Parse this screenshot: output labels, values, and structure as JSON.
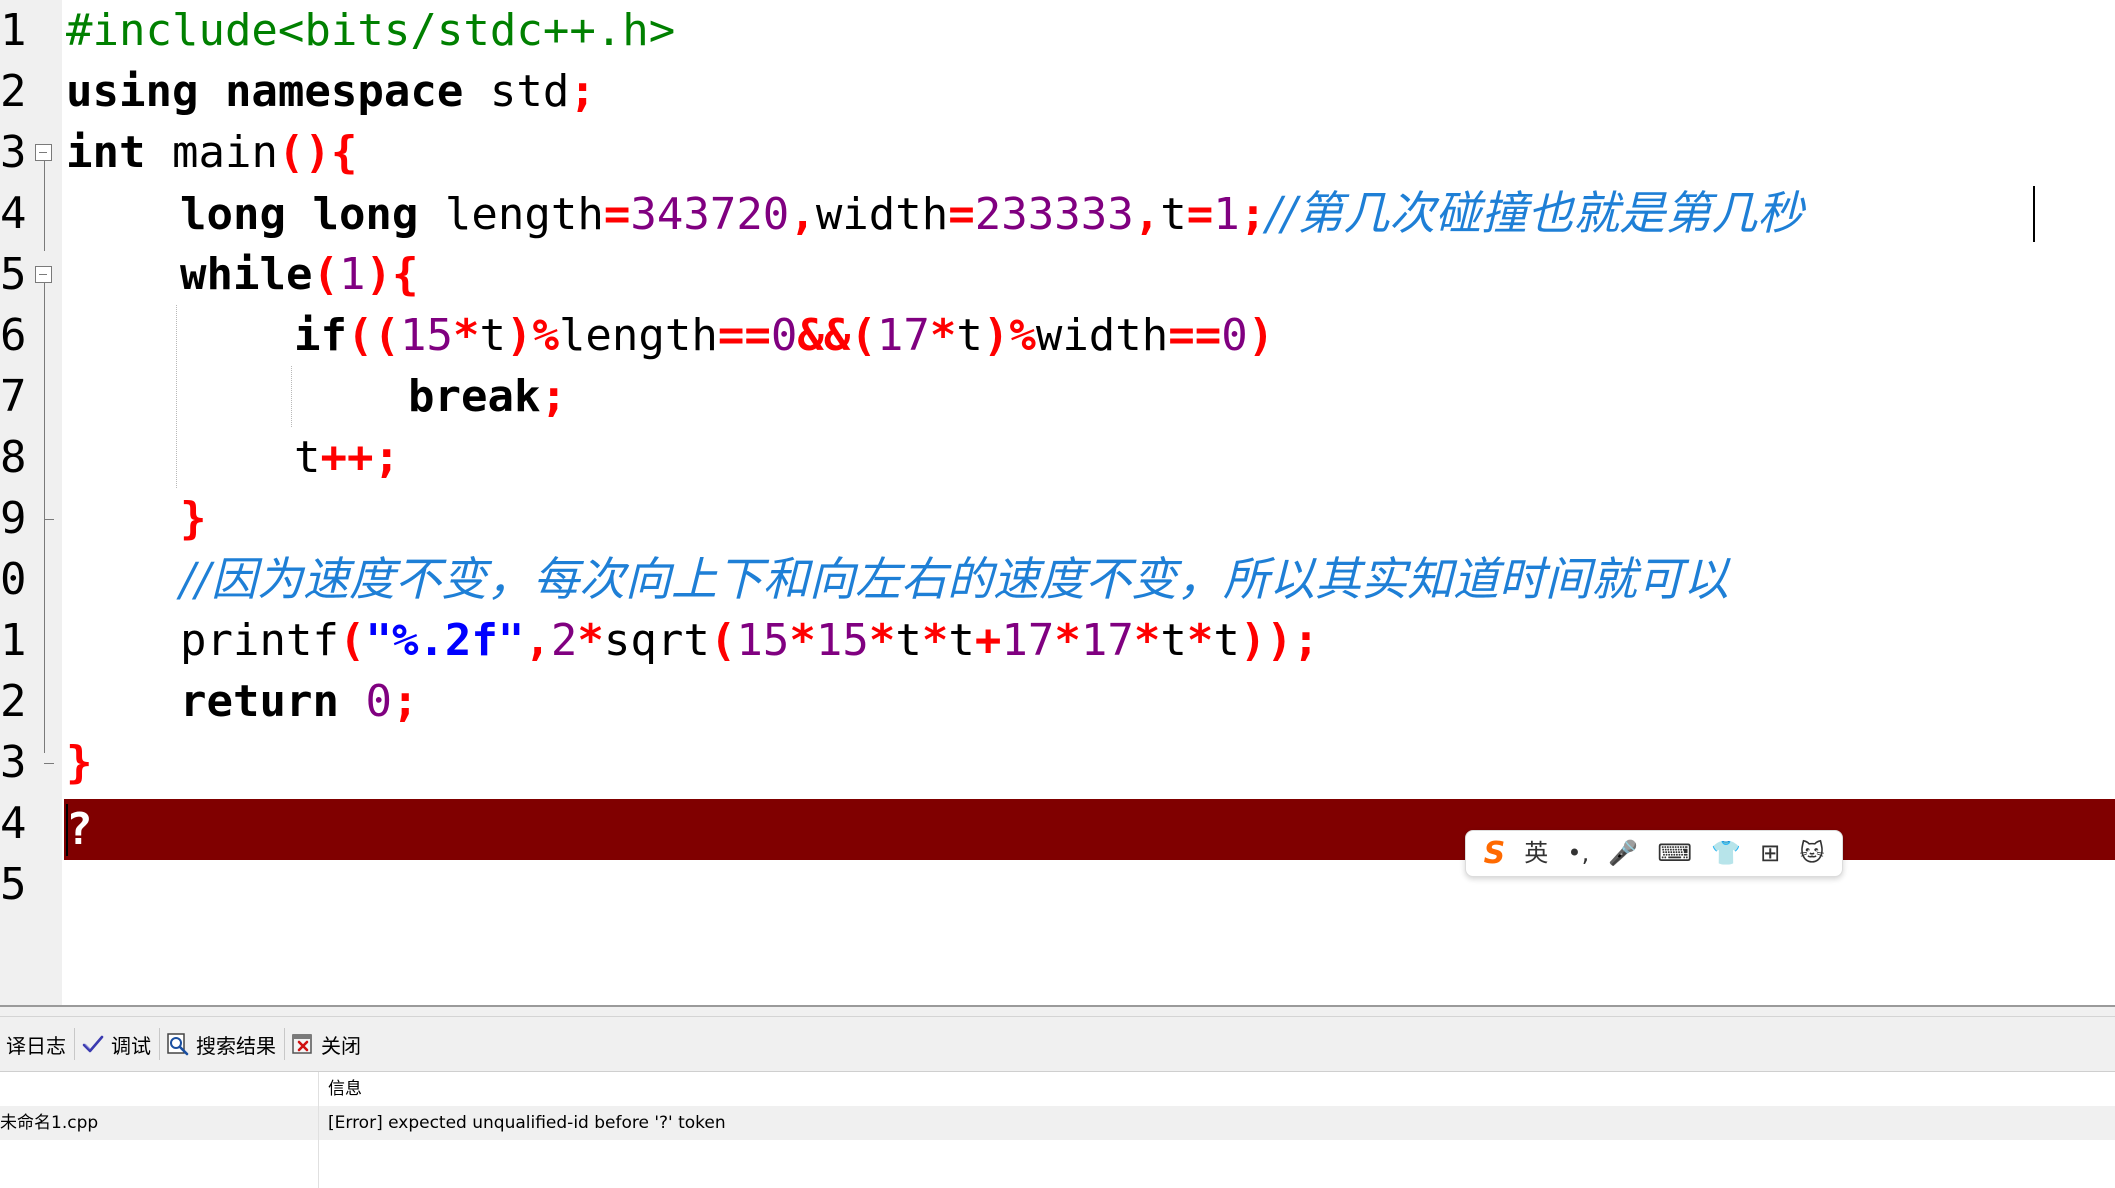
{
  "editor": {
    "line_numbers": [
      "1",
      "2",
      "3",
      "4",
      "5",
      "6",
      "7",
      "8",
      "9",
      "0",
      "1",
      "2",
      "3",
      "4",
      "5"
    ],
    "code": {
      "l1_include": "#include<bits/stdc++.h>",
      "l2_using": "using namespace",
      "l2_std": " std",
      "l2_semi": ";",
      "l3_int": "int",
      "l3_main": " main",
      "l3_paren": "(){",
      "l4_long": "long long",
      "l4_length": " length",
      "l4_eq1": "=",
      "l4_v1": "343720",
      "l4_c1": ",",
      "l4_width": "width",
      "l4_eq2": "=",
      "l4_v2": "233333",
      "l4_c2": ",",
      "l4_t": "t",
      "l4_eq3": "=",
      "l4_v3": "1",
      "l4_semi": ";",
      "l4_comment": "//第几次碰撞也就是第几秒",
      "l5_while": "while",
      "l5_open": "(",
      "l5_one": "1",
      "l5_close": "){",
      "l6_if": "if",
      "l6_a": "((",
      "l6_15": "15",
      "l6_b": "*",
      "l6_t1": "t",
      "l6_c": ")%",
      "l6_length": "length",
      "l6_d": "==",
      "l6_0a": "0",
      "l6_e": "&&(",
      "l6_17": "17",
      "l6_f": "*",
      "l6_t2": "t",
      "l6_g": ")%",
      "l6_width": "width",
      "l6_h": "==",
      "l6_0b": "0",
      "l6_i": ")",
      "l7_break": "break",
      "l7_semi": ";",
      "l8_t": "t",
      "l8_ops": "++;",
      "l9_brace": "}",
      "l10_comment": "//因为速度不变，每次向上下和向左右的速度不变，所以其实知道时间就可以",
      "l11_printf": "printf",
      "l11_open": "(",
      "l11_str": "\"%.2f\"",
      "l11_comma": ",",
      "l11_2": "2",
      "l11_m1": "*",
      "l11_sqrt": "sqrt",
      "l11_o2": "(",
      "l11_a": "15",
      "l11_m2": "*",
      "l11_b": "15",
      "l11_m3": "*",
      "l11_t1": "t",
      "l11_m4": "*",
      "l11_t2": "t",
      "l11_plus": "+",
      "l11_c": "17",
      "l11_m5": "*",
      "l11_d": "17",
      "l11_m6": "*",
      "l11_t3": "t",
      "l11_m7": "*",
      "l11_t4": "t",
      "l11_end": "));",
      "l12_return": "return",
      "l12_zero": " 0",
      "l12_semi": ";",
      "l13_brace": "}",
      "l14_error_char": "?"
    }
  },
  "ime_toolbar": {
    "logo": "S",
    "lang": "英",
    "items": [
      "•,",
      "🎤",
      "⌨",
      "👕",
      "⊞",
      "🐱"
    ]
  },
  "panel": {
    "tabs": [
      {
        "label": "译日志",
        "icon": "compile-log-icon"
      },
      {
        "label": "调试",
        "icon": "check-icon"
      },
      {
        "label": "搜索结果",
        "icon": "search-icon"
      },
      {
        "label": "关闭",
        "icon": "close-icon"
      }
    ],
    "header": {
      "file": "",
      "message": "信息"
    },
    "rows": [
      {
        "file": "未命名1.cpp",
        "message": "[Error] expected unqualified-id before '?' token"
      }
    ]
  }
}
